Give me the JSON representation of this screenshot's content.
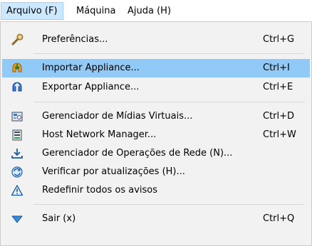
{
  "menubar": {
    "items": [
      {
        "label": "Arquivo (F)"
      },
      {
        "label": "Máquina"
      },
      {
        "label": "Ajuda (H)"
      }
    ]
  },
  "menu": {
    "items": [
      {
        "label": "Preferências...",
        "shortcut": "Ctrl+G",
        "icon": "wrench-icon"
      },
      {
        "label": "Importar Appliance...",
        "shortcut": "Ctrl+I",
        "icon": "import-appliance-icon",
        "highlighted": true
      },
      {
        "label": "Exportar Appliance...",
        "shortcut": "Ctrl+E",
        "icon": "export-appliance-icon"
      },
      {
        "label": "Gerenciador de Mídias Virtuais...",
        "shortcut": "Ctrl+D",
        "icon": "media-manager-icon"
      },
      {
        "label": "Host Network Manager...",
        "shortcut": "Ctrl+W",
        "icon": "host-network-icon"
      },
      {
        "label": "Gerenciador de Operações de Rede (N)...",
        "shortcut": "",
        "icon": "network-operations-icon"
      },
      {
        "label": "Verificar por atualizações (H)...",
        "shortcut": "",
        "icon": "check-updates-icon"
      },
      {
        "label": "Redefinir todos os avisos",
        "shortcut": "",
        "icon": "warning-icon"
      },
      {
        "label": "Sair (x)",
        "shortcut": "Ctrl+Q",
        "icon": "exit-icon"
      }
    ]
  },
  "colors": {
    "highlight": "#91c9f7",
    "menu_background": "#f2f2f2",
    "active_menubar": "#cce8ff"
  }
}
